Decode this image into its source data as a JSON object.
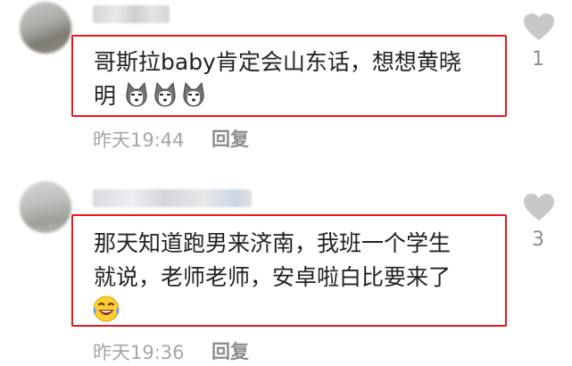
{
  "comments": [
    {
      "text_line1": "哥斯拉baby肯定会山东话，想想黄晓",
      "text_line2": "明",
      "emoji_count_note": "",
      "time": "昨天19:44",
      "reply_label": "回复",
      "likes": "1",
      "emojis": [
        "husky-emoji",
        "husky-emoji",
        "husky-emoji"
      ]
    },
    {
      "text_line1": "那天知道跑男来济南，我班一个学生",
      "text_line2": "就说，老师老师，安卓啦白比要来了",
      "time": "昨天19:36",
      "reply_label": "回复",
      "likes": "3",
      "emojis": [
        "laughing-crying-emoji"
      ]
    }
  ],
  "colors": {
    "highlight_border": "#e8191d",
    "like_icon": "#c8c8c8",
    "meta_text": "#a6a6a6"
  }
}
